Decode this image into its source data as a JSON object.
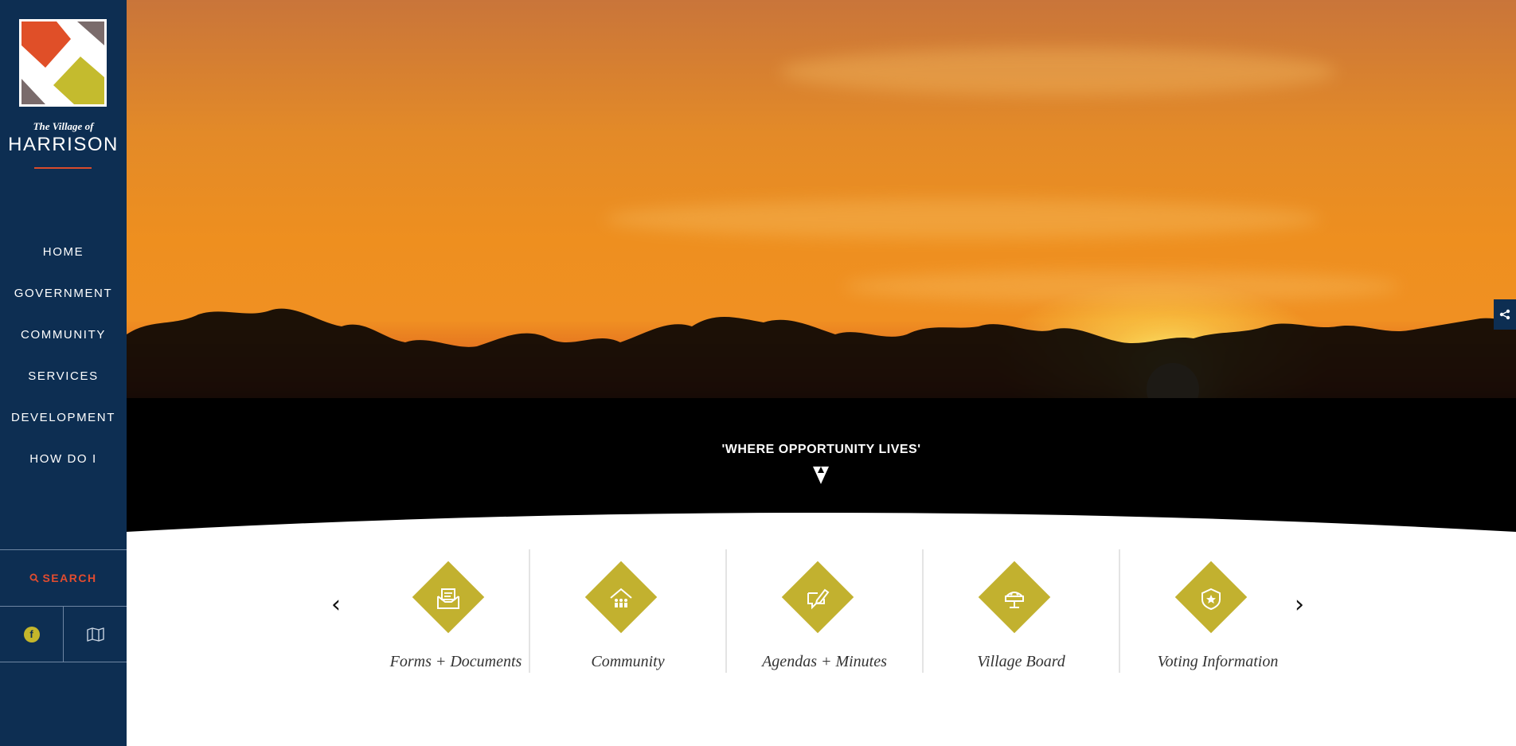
{
  "brand": {
    "village_of": "The Village of",
    "name": "HARRISON",
    "logo_colors": [
      "#e04f28",
      "#c4bb2e",
      "#7a6b6b"
    ]
  },
  "nav": {
    "items": [
      "HOME",
      "GOVERNMENT",
      "COMMUNITY",
      "SERVICES",
      "DEVELOPMENT",
      "HOW DO I"
    ]
  },
  "sidebar": {
    "search_label": "SEARCH",
    "icons": [
      "facebook-icon",
      "map-icon"
    ]
  },
  "hero": {
    "tagline": "'WHERE OPPORTUNITY LIVES'"
  },
  "quick_links": {
    "items": [
      {
        "label": "Forms + Documents",
        "icon": "forms-icon"
      },
      {
        "label": "Community",
        "icon": "community-icon"
      },
      {
        "label": "Agendas + Minutes",
        "icon": "agendas-icon"
      },
      {
        "label": "Village Board",
        "icon": "board-icon"
      },
      {
        "label": "Voting Information",
        "icon": "voting-icon"
      }
    ]
  },
  "colors": {
    "sidebar_bg": "#0d2e52",
    "accent_red": "#e24c2f",
    "diamond_gold": "#c2b12f"
  }
}
